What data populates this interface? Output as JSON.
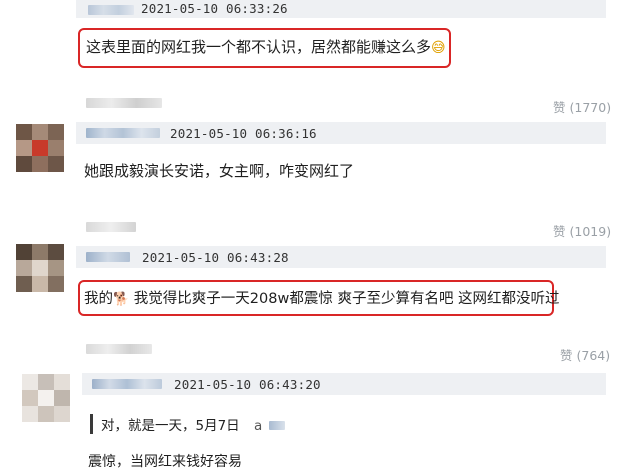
{
  "comments": [
    {
      "timestamp": "2021-05-10 06:33:26",
      "text": "这表里面的网红我一个都不认识，居然都能赚这么多",
      "emoji": "😅"
    },
    {
      "timestamp": "2021-05-10 06:36:16",
      "text": "她跟成毅演长安诺，女主啊，咋变网红了",
      "like_label": "赞",
      "like_count": "(1770)"
    },
    {
      "timestamp": "2021-05-10 06:43:28",
      "text_prefix": "我的",
      "emoji": "🐕",
      "text": "我觉得比爽子一天208w都震惊 爽子至少算有名吧 这网红都没听过",
      "like_label": "赞",
      "like_count": "(1019)"
    },
    {
      "timestamp": "2021-05-10 06:43:20",
      "quote": "对，就是一天，5月7日",
      "quote_tail": "a",
      "text": "震惊，当网红来钱好容易",
      "like_label": "赞",
      "like_count": "(764)"
    }
  ],
  "colors": {
    "highlight_border": "#d92626",
    "meta_bar": "#eef0f3",
    "like_text": "#9aa0a6"
  }
}
